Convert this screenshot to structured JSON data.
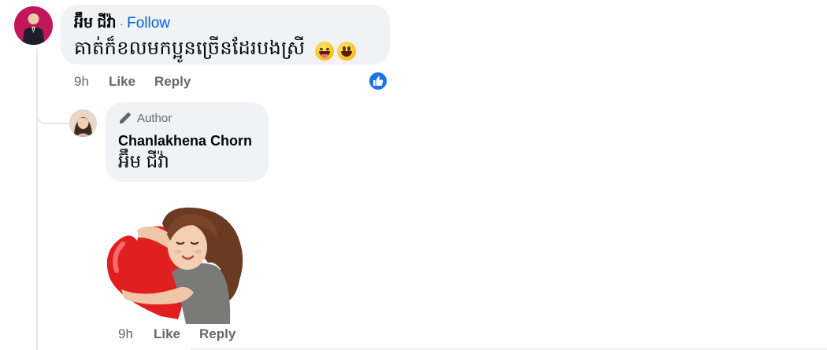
{
  "comment": {
    "author": "អ៊ឹម ជីវ៉ា",
    "separator": "·",
    "follow_label": "Follow",
    "text": "គាត់ក៏ខលមកប្អូនច្រើនដែរបងស្រី",
    "emojis": [
      "grinning-squinting-tongue-emoji",
      "grinning-face-emoji"
    ],
    "time": "9h",
    "like_label": "Like",
    "reply_label": "Reply",
    "reaction": "like",
    "reaction_color": "#1b74e4"
  },
  "reply": {
    "badge_label": "Author",
    "author": "Chanlakhena Chorn",
    "text": "អ៊ឹម ជីវ៉ា",
    "sticker": "heart-hug-sticker",
    "time": "9h",
    "like_label": "Like",
    "reply_label": "Reply"
  },
  "colors": {
    "bubble": "#f0f2f5",
    "link": "#0064d1",
    "meta": "#65676b"
  }
}
